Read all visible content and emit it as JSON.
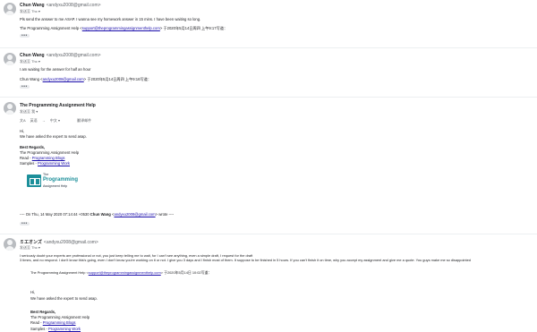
{
  "messages": [
    {
      "sender": "Chun Wang",
      "address": "<andyxu2008@gmail.com>",
      "to": "发送至 Thc ▾",
      "line1": "Pls send the answer to me ASAP. I wanna see my homework answer in 15 mins. I have been waiting so long.",
      "quote_prefix": "The Programming Assignment Help <",
      "quote_link": "support@theprogrammingassignmenthelp.com",
      "quote_suffix": "> 于2020年5月14日周四 上午9:17写道："
    },
    {
      "sender": "Chun Wang",
      "address": "<andyxu2008@gmail.com>",
      "to": "发送至 Thc ▾",
      "line1": "I am waiting for the answer for half an hour",
      "quote_prefix": "Chun Wang <",
      "quote_link": "andyxu2008@gmail.com",
      "quote_suffix": "> 于2020年5月14日周四 上午9:16写道："
    },
    {
      "sender": "The Programming Assignment Help",
      "to": "发送至 我 ▾",
      "toolbar": {
        "language": "英语",
        "translate": "中文",
        "translate_label": "翻译邮件"
      },
      "greeting": "Hi,",
      "body": "We have asked the expert to send asap.",
      "regards": "Best Regards,",
      "signature_name": "The Programming Assignment Help",
      "read_label": "Read - ",
      "read_link": "Programming Blogs",
      "samples_label": "Samples - ",
      "samples_link": "Programming Work",
      "logo": {
        "top": "The",
        "main": "Programming",
        "sub": "Assignment Help"
      },
      "wrote_prefix": "---- On Thu, 14 May 2020 07:14:44 +0530 ",
      "wrote_name": "Chun Wang",
      "wrote_open": " <",
      "wrote_link": "andyxu2008@gmail.com",
      "wrote_suffix": "> wrote ----"
    },
    {
      "sender": "ミエオンズ",
      "address": "<andyxu2008@gmail.com>",
      "to": "发送至 Thc ▾",
      "line1": "I seriously doubt your experts are professional or not, you just keep telling me to wait, for I can't see anything, even a simple draft, I request for the draft",
      "line2": "3 times, and no respond. I don't know this's going, even I don't know you're working on it or not. I give you 3 days and I finish most of them. It suppose to be finished in 5 hours. If you can't finish it on time, why you accept my assignment and give me a quote. You guys make me so disappointed",
      "quote_prefix": "The Programming Assignment Help <",
      "quote_link": "support@theprogrammingassignmenthelp.com",
      "quote_suffix": "> 于2020年5月14日 10:02写道：",
      "greeting": "Hi,",
      "body": "We have asked the expert to send asap.",
      "regards": "Best Regards,",
      "signature_name": "The Programming Assignment Help",
      "read_label": "Read - ",
      "read_link": "Programming Blogs",
      "samples_label": "Samples - ",
      "samples_link": "Programming Work"
    }
  ],
  "ellipsis": "•••"
}
